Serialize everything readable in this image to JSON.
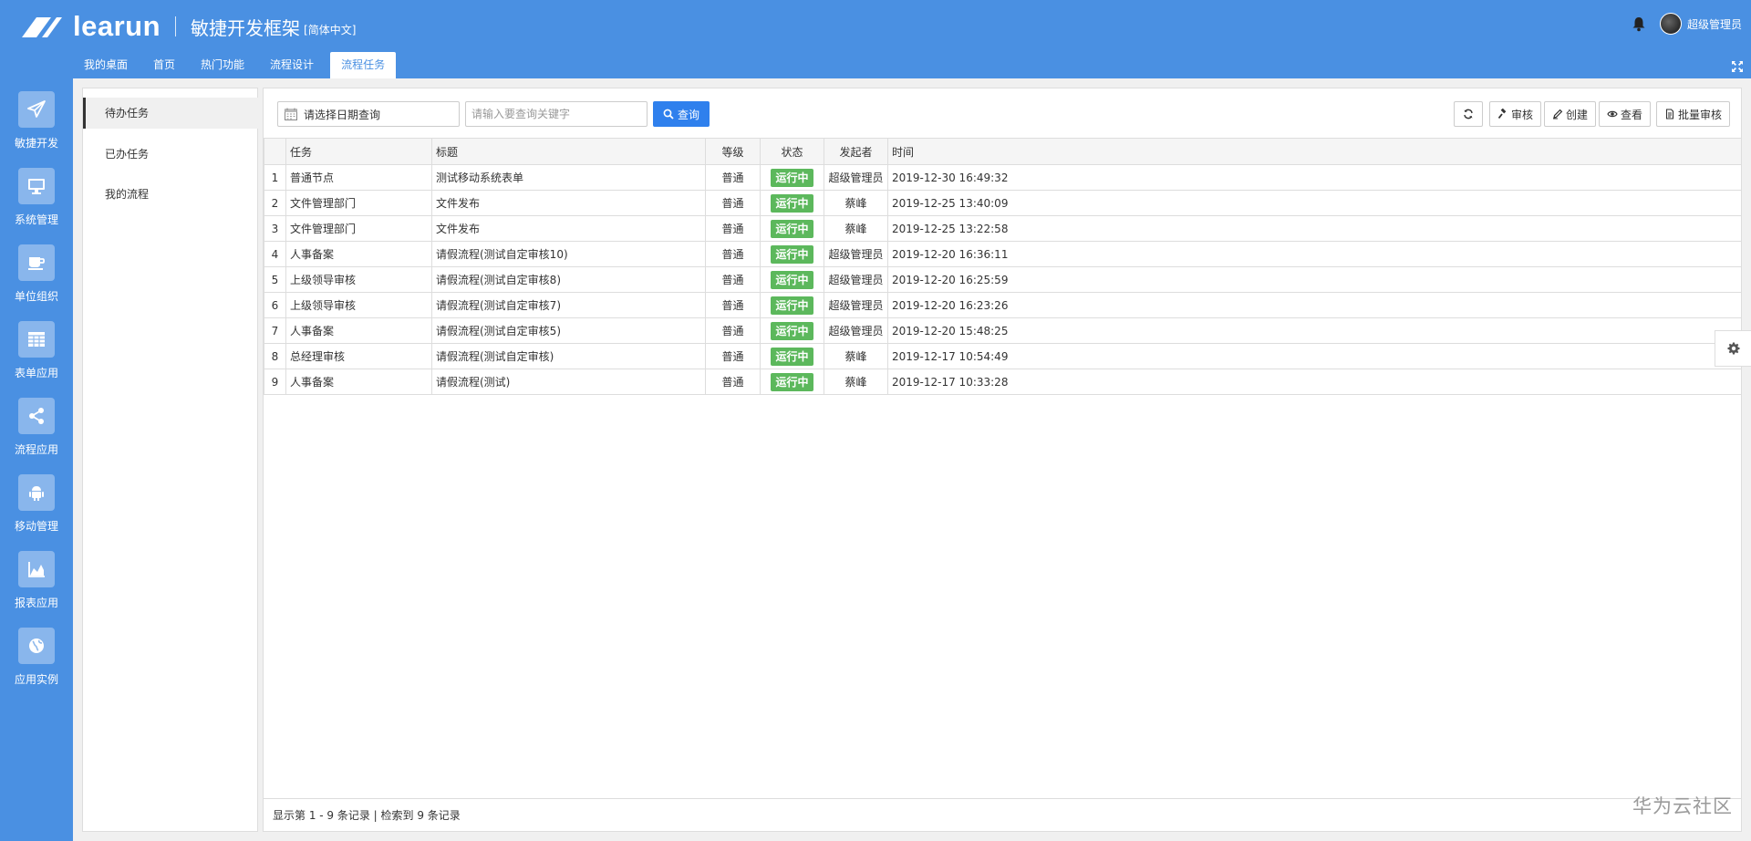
{
  "header": {
    "logo_text": "learun",
    "title": "敏捷开发框架",
    "lang": "[简体中文]",
    "user_name": "超级管理员"
  },
  "nav_tabs": [
    "我的桌面",
    "首页",
    "热门功能",
    "流程设计",
    "流程任务"
  ],
  "sidebar": {
    "items": [
      {
        "label": "敏捷开发",
        "icon": "paper-plane-icon"
      },
      {
        "label": "系统管理",
        "icon": "monitor-icon"
      },
      {
        "label": "单位组织",
        "icon": "coffee-icon"
      },
      {
        "label": "表单应用",
        "icon": "table-icon"
      },
      {
        "label": "流程应用",
        "icon": "share-icon"
      },
      {
        "label": "移动管理",
        "icon": "android-icon"
      },
      {
        "label": "报表应用",
        "icon": "area-chart-icon"
      },
      {
        "label": "应用实例",
        "icon": "globe-icon"
      }
    ]
  },
  "sub_menu": [
    "待办任务",
    "已办任务",
    "我的流程"
  ],
  "toolbar": {
    "date_placeholder": "请选择日期查询",
    "keyword_placeholder": "请输入要查询关键字",
    "search_label": "查询",
    "approve_label": "审核",
    "create_label": "创建",
    "view_label": "查看",
    "batch_label": "批量审核"
  },
  "table": {
    "columns": [
      "任务",
      "标题",
      "等级",
      "状态",
      "发起者",
      "时间"
    ],
    "rows": [
      {
        "no": "1",
        "task": "普通节点",
        "title": "测试移动系统表单",
        "level": "普通",
        "status": "运行中",
        "creator": "超级管理员",
        "time": "2019-12-30 16:49:32"
      },
      {
        "no": "2",
        "task": "文件管理部门",
        "title": "文件发布",
        "level": "普通",
        "status": "运行中",
        "creator": "蔡峰",
        "time": "2019-12-25 13:40:09"
      },
      {
        "no": "3",
        "task": "文件管理部门",
        "title": "文件发布",
        "level": "普通",
        "status": "运行中",
        "creator": "蔡峰",
        "time": "2019-12-25 13:22:58"
      },
      {
        "no": "4",
        "task": "人事备案",
        "title": "请假流程(测试自定审核10)",
        "level": "普通",
        "status": "运行中",
        "creator": "超级管理员",
        "time": "2019-12-20 16:36:11"
      },
      {
        "no": "5",
        "task": "上级领导审核",
        "title": "请假流程(测试自定审核8)",
        "level": "普通",
        "status": "运行中",
        "creator": "超级管理员",
        "time": "2019-12-20 16:25:59"
      },
      {
        "no": "6",
        "task": "上级领导审核",
        "title": "请假流程(测试自定审核7)",
        "level": "普通",
        "status": "运行中",
        "creator": "超级管理员",
        "time": "2019-12-20 16:23:26"
      },
      {
        "no": "7",
        "task": "人事备案",
        "title": "请假流程(测试自定审核5)",
        "level": "普通",
        "status": "运行中",
        "creator": "超级管理员",
        "time": "2019-12-20 15:48:25"
      },
      {
        "no": "8",
        "task": "总经理审核",
        "title": "请假流程(测试自定审核)",
        "level": "普通",
        "status": "运行中",
        "creator": "蔡峰",
        "time": "2019-12-17 10:54:49"
      },
      {
        "no": "9",
        "task": "人事备案",
        "title": "请假流程(测试)",
        "level": "普通",
        "status": "运行中",
        "creator": "蔡峰",
        "time": "2019-12-17 10:33:28"
      }
    ]
  },
  "footer": {
    "record_text": "显示第 1 - 9 条记录 | 检索到 9 条记录"
  },
  "watermark": "华为云社区",
  "colors": {
    "brand": "#4a90e2",
    "search_button": "#2f80ed",
    "status_running": "#5cb85c"
  }
}
